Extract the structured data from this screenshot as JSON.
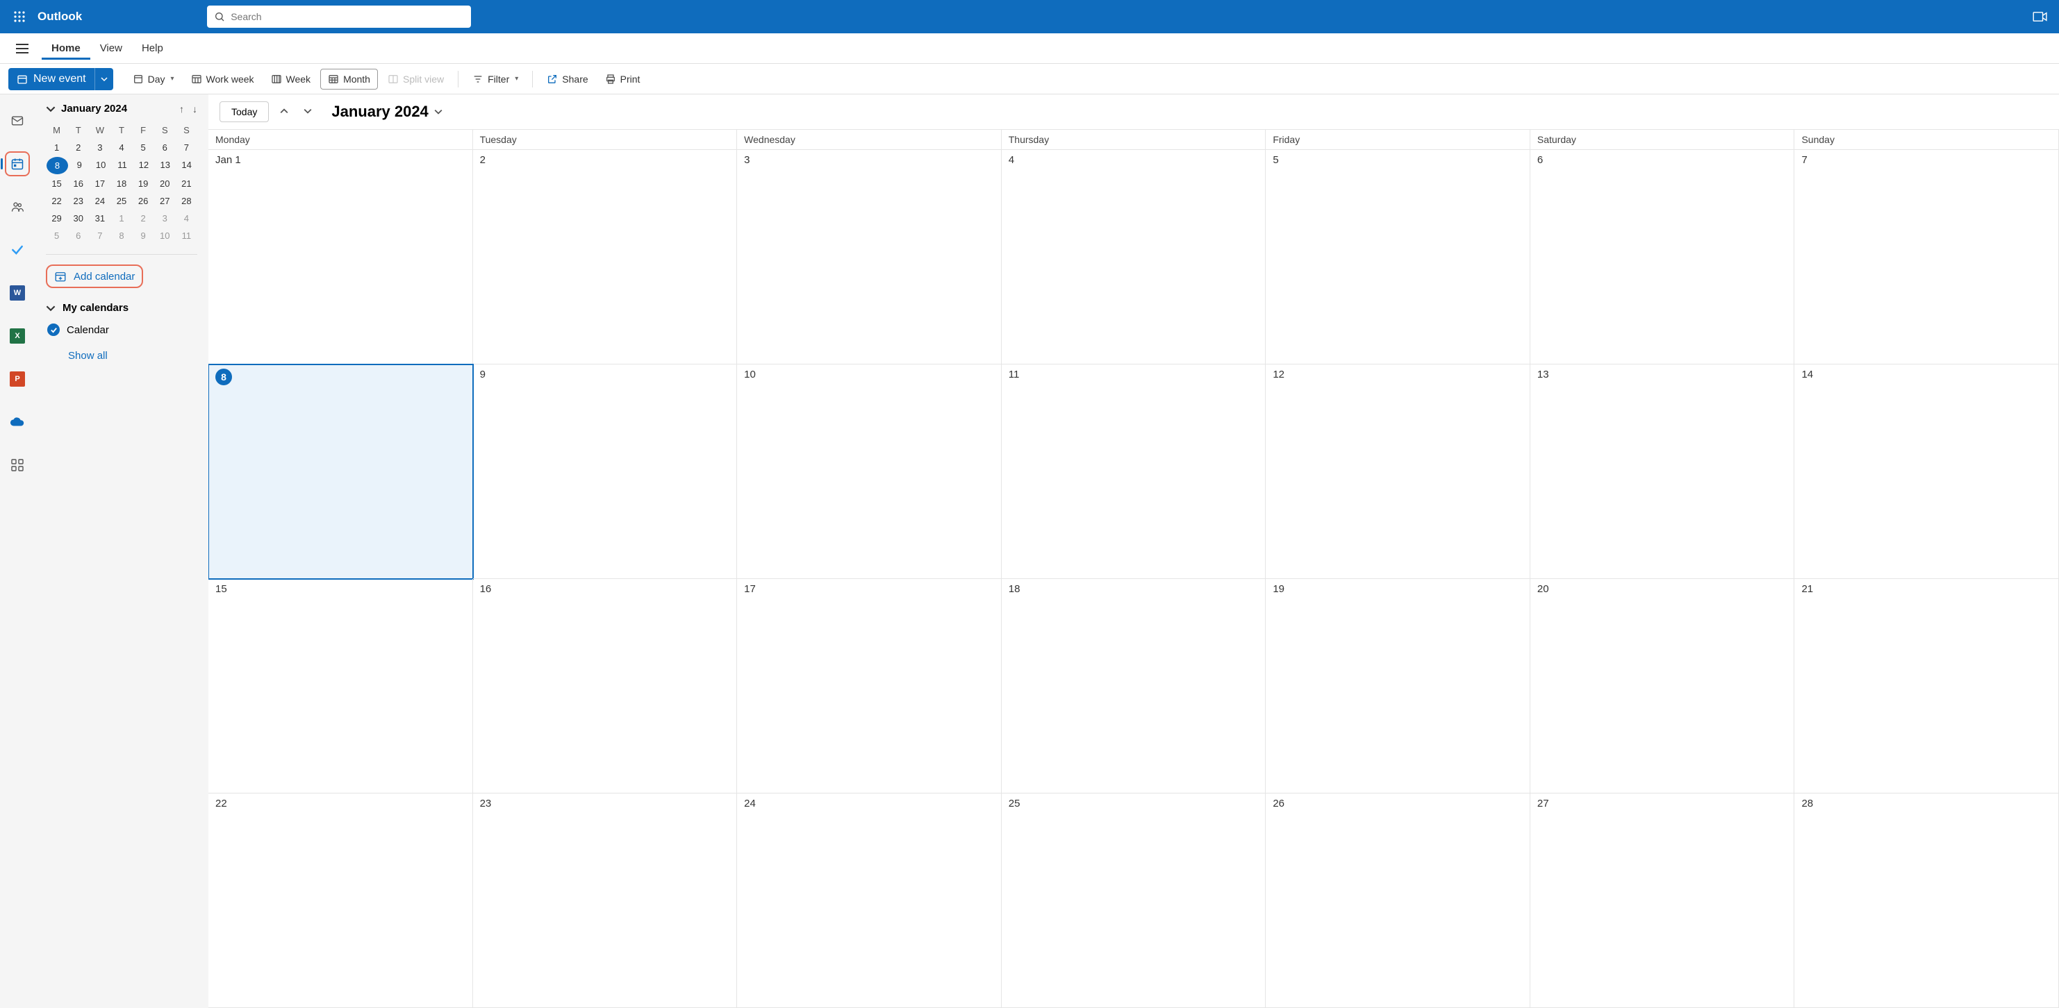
{
  "header": {
    "app_name": "Outlook",
    "search_placeholder": "Search"
  },
  "ribbon": {
    "tabs": [
      "Home",
      "View",
      "Help"
    ],
    "active_tab": 0
  },
  "toolbar": {
    "new_event": "New event",
    "day": "Day",
    "work_week": "Work week",
    "week": "Week",
    "month": "Month",
    "split_view": "Split view",
    "filter": "Filter",
    "share": "Share",
    "print": "Print",
    "selected_view": "month"
  },
  "sidebar": {
    "mini_month": "January 2024",
    "day_headers": [
      "M",
      "T",
      "W",
      "T",
      "F",
      "S",
      "S"
    ],
    "weeks": [
      [
        "1",
        "2",
        "3",
        "4",
        "5",
        "6",
        "7"
      ],
      [
        "8",
        "9",
        "10",
        "11",
        "12",
        "13",
        "14"
      ],
      [
        "15",
        "16",
        "17",
        "18",
        "19",
        "20",
        "21"
      ],
      [
        "22",
        "23",
        "24",
        "25",
        "26",
        "27",
        "28"
      ],
      [
        "29",
        "30",
        "31",
        "1",
        "2",
        "3",
        "4"
      ],
      [
        "5",
        "6",
        "7",
        "8",
        "9",
        "10",
        "11"
      ]
    ],
    "today_row": 1,
    "today_col": 0,
    "muted_start": {
      "row": 4,
      "col": 3
    },
    "add_calendar": "Add calendar",
    "my_calendars": "My calendars",
    "calendar_item": "Calendar",
    "show_all": "Show all"
  },
  "calendar": {
    "today_btn": "Today",
    "title": "January 2024",
    "day_headers": [
      "Monday",
      "Tuesday",
      "Wednesday",
      "Thursday",
      "Friday",
      "Saturday",
      "Sunday"
    ],
    "weeks": [
      [
        "Jan 1",
        "2",
        "3",
        "4",
        "5",
        "6",
        "7"
      ],
      [
        "8",
        "9",
        "10",
        "11",
        "12",
        "13",
        "14"
      ],
      [
        "15",
        "16",
        "17",
        "18",
        "19",
        "20",
        "21"
      ],
      [
        "22",
        "23",
        "24",
        "25",
        "26",
        "27",
        "28"
      ]
    ],
    "today_row": 1,
    "today_col": 0
  },
  "colors": {
    "primary": "#0F6CBD",
    "highlight": "#E86E58"
  }
}
